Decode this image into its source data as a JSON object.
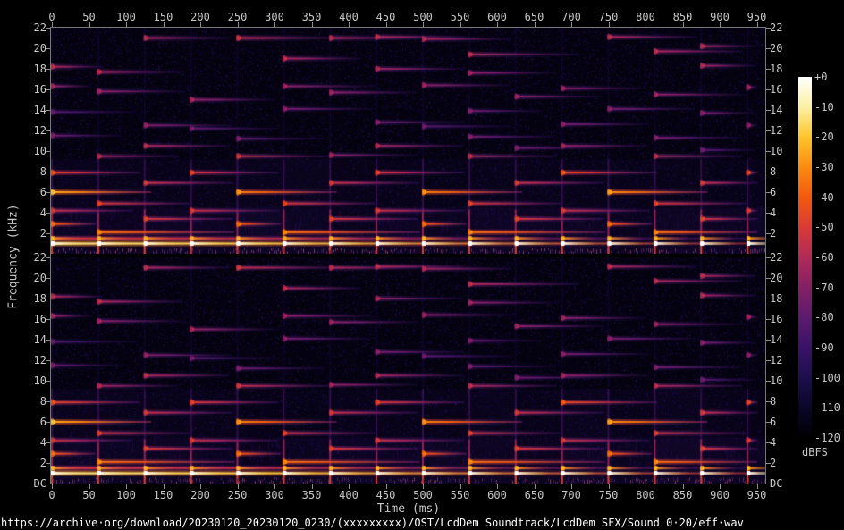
{
  "axes": {
    "freq_label": "Frequency (kHz)",
    "time_label": "Time (ms)",
    "time_ticks": [
      0,
      50,
      100,
      150,
      200,
      250,
      300,
      350,
      400,
      450,
      500,
      550,
      600,
      650,
      700,
      750,
      800,
      850,
      900,
      950
    ],
    "freq_ticks": [
      22,
      20,
      18,
      16,
      14,
      12,
      10,
      8,
      6,
      4,
      2
    ],
    "dc_label": "DC"
  },
  "colorbar": {
    "unit": "dBFS",
    "tick_labels": [
      "+0",
      "-10",
      "-20",
      "-30",
      "-40",
      "-50",
      "-60",
      "-70",
      "-80",
      "-90",
      "-100",
      "-110",
      "-120"
    ]
  },
  "footer": {
    "url": "https://archive·org/download/20230120_20230120_0230/(xxxxxxxxx)/OST/LcdDem Soundtrack/LcdDem SFX/Sound 0·20/eff·wav"
  },
  "chart_data": {
    "type": "heatmap",
    "subtype": "stereo-spectrogram",
    "channels": [
      "left",
      "right"
    ],
    "x": {
      "label": "Time (ms)",
      "range": [
        0,
        962
      ],
      "tick_step": 50
    },
    "y": {
      "label": "Frequency (kHz)",
      "range": [
        0,
        22
      ],
      "tick_step": 2
    },
    "z": {
      "label": "dBFS",
      "range": [
        -120,
        0
      ],
      "tick_step": 10
    },
    "grid": false,
    "legend_position": "right-colorbar",
    "onset_step_ms": 62.5,
    "duration_ms": 952,
    "colormap_stops": [
      [
        0.0,
        "#000003"
      ],
      [
        0.083,
        "#0a0628"
      ],
      [
        0.167,
        "#1d0e4e"
      ],
      [
        0.25,
        "#3a1267"
      ],
      [
        0.333,
        "#5c1a6d"
      ],
      [
        0.417,
        "#842065"
      ],
      [
        0.5,
        "#b02a58"
      ],
      [
        0.583,
        "#d93a35"
      ],
      [
        0.667,
        "#f4590e"
      ],
      [
        0.75,
        "#fb8b10"
      ],
      [
        0.833,
        "#fdc52a"
      ],
      [
        0.917,
        "#fcf0a4"
      ],
      [
        1.0,
        "#ffffff"
      ]
    ],
    "tones_format": "[onset_ms, freq_kHz, duration_ms, intensity_0to1]",
    "tones": [
      [
        0,
        18.2,
        70,
        0.5
      ],
      [
        0,
        16.3,
        55,
        0.45
      ],
      [
        0,
        13.8,
        115,
        0.33
      ],
      [
        0,
        11.5,
        95,
        0.38
      ],
      [
        62,
        17.7,
        115,
        0.5
      ],
      [
        62,
        15.8,
        120,
        0.44
      ],
      [
        62,
        9.5,
        110,
        0.48
      ],
      [
        125,
        21.0,
        115,
        0.5
      ],
      [
        125,
        12.5,
        120,
        0.42
      ],
      [
        125,
        10.5,
        115,
        0.5
      ],
      [
        187,
        15.0,
        115,
        0.46
      ],
      [
        187,
        12.2,
        120,
        0.36
      ],
      [
        250,
        21.0,
        145,
        0.54
      ],
      [
        250,
        11.2,
        120,
        0.38
      ],
      [
        250,
        9.5,
        125,
        0.54
      ],
      [
        312,
        19.0,
        105,
        0.5
      ],
      [
        312,
        16.3,
        125,
        0.44
      ],
      [
        312,
        14.1,
        120,
        0.4
      ],
      [
        375,
        21.0,
        120,
        0.5
      ],
      [
        375,
        15.7,
        120,
        0.44
      ],
      [
        375,
        9.6,
        120,
        0.45
      ],
      [
        437,
        21.1,
        120,
        0.5
      ],
      [
        437,
        18.0,
        120,
        0.46
      ],
      [
        437,
        12.8,
        120,
        0.4
      ],
      [
        437,
        10.5,
        120,
        0.48
      ],
      [
        500,
        20.9,
        120,
        0.48
      ],
      [
        500,
        16.4,
        120,
        0.44
      ],
      [
        500,
        12.4,
        120,
        0.34
      ],
      [
        562,
        19.4,
        150,
        0.5
      ],
      [
        562,
        17.6,
        120,
        0.44
      ],
      [
        562,
        13.9,
        100,
        0.38
      ],
      [
        562,
        11.4,
        120,
        0.38
      ],
      [
        562,
        9.5,
        120,
        0.5
      ],
      [
        625,
        15.3,
        120,
        0.44
      ],
      [
        625,
        10.3,
        120,
        0.38
      ],
      [
        687,
        16.1,
        115,
        0.44
      ],
      [
        687,
        12.6,
        120,
        0.4
      ],
      [
        687,
        10.5,
        120,
        0.45
      ],
      [
        750,
        21.1,
        120,
        0.5
      ],
      [
        750,
        14.1,
        120,
        0.4
      ],
      [
        812,
        19.7,
        120,
        0.5
      ],
      [
        812,
        15.5,
        125,
        0.44
      ],
      [
        812,
        11.3,
        120,
        0.38
      ],
      [
        812,
        9.5,
        120,
        0.5
      ],
      [
        875,
        20.2,
        75,
        0.5
      ],
      [
        875,
        18.3,
        75,
        0.48
      ],
      [
        875,
        13.7,
        75,
        0.4
      ],
      [
        875,
        10.1,
        75,
        0.34
      ],
      [
        937,
        16.2,
        16,
        0.44
      ],
      [
        937,
        12.5,
        16,
        0.4
      ],
      [
        0,
        7.9,
        120,
        0.62
      ],
      [
        187,
        7.9,
        120,
        0.58
      ],
      [
        437,
        7.9,
        120,
        0.58
      ],
      [
        687,
        7.9,
        130,
        0.64
      ],
      [
        937,
        7.9,
        16,
        0.58
      ],
      [
        125,
        6.9,
        120,
        0.55
      ],
      [
        375,
        6.9,
        120,
        0.55
      ],
      [
        625,
        6.9,
        120,
        0.55
      ],
      [
        875,
        6.9,
        78,
        0.55
      ],
      [
        0,
        6.0,
        135,
        0.8
      ],
      [
        250,
        6.0,
        135,
        0.74
      ],
      [
        500,
        6.0,
        135,
        0.74
      ],
      [
        750,
        6.0,
        135,
        0.76
      ],
      [
        62,
        4.9,
        125,
        0.58
      ],
      [
        312,
        4.9,
        125,
        0.58
      ],
      [
        562,
        4.9,
        125,
        0.58
      ],
      [
        812,
        4.9,
        125,
        0.58
      ],
      [
        0,
        4.2,
        110,
        0.55
      ],
      [
        187,
        4.2,
        120,
        0.55
      ],
      [
        437,
        4.2,
        120,
        0.55
      ],
      [
        687,
        4.2,
        120,
        0.55
      ],
      [
        937,
        4.2,
        16,
        0.55
      ],
      [
        125,
        3.4,
        120,
        0.58
      ],
      [
        375,
        3.4,
        120,
        0.58
      ],
      [
        625,
        3.4,
        120,
        0.58
      ],
      [
        875,
        3.4,
        78,
        0.58
      ],
      [
        0,
        2.9,
        60,
        0.68
      ],
      [
        250,
        2.9,
        60,
        0.68
      ],
      [
        500,
        2.9,
        60,
        0.68
      ],
      [
        750,
        2.9,
        60,
        0.68
      ],
      [
        62,
        2.1,
        185,
        0.72
      ],
      [
        312,
        2.1,
        185,
        0.72
      ],
      [
        562,
        2.1,
        185,
        0.72
      ],
      [
        812,
        2.1,
        140,
        0.72
      ]
    ],
    "pulse_lines": [
      {
        "f": 1.5,
        "base": 0.58,
        "head": 0.78
      },
      {
        "f": 1.0,
        "base": 0.9,
        "head": 1.0
      }
    ]
  }
}
